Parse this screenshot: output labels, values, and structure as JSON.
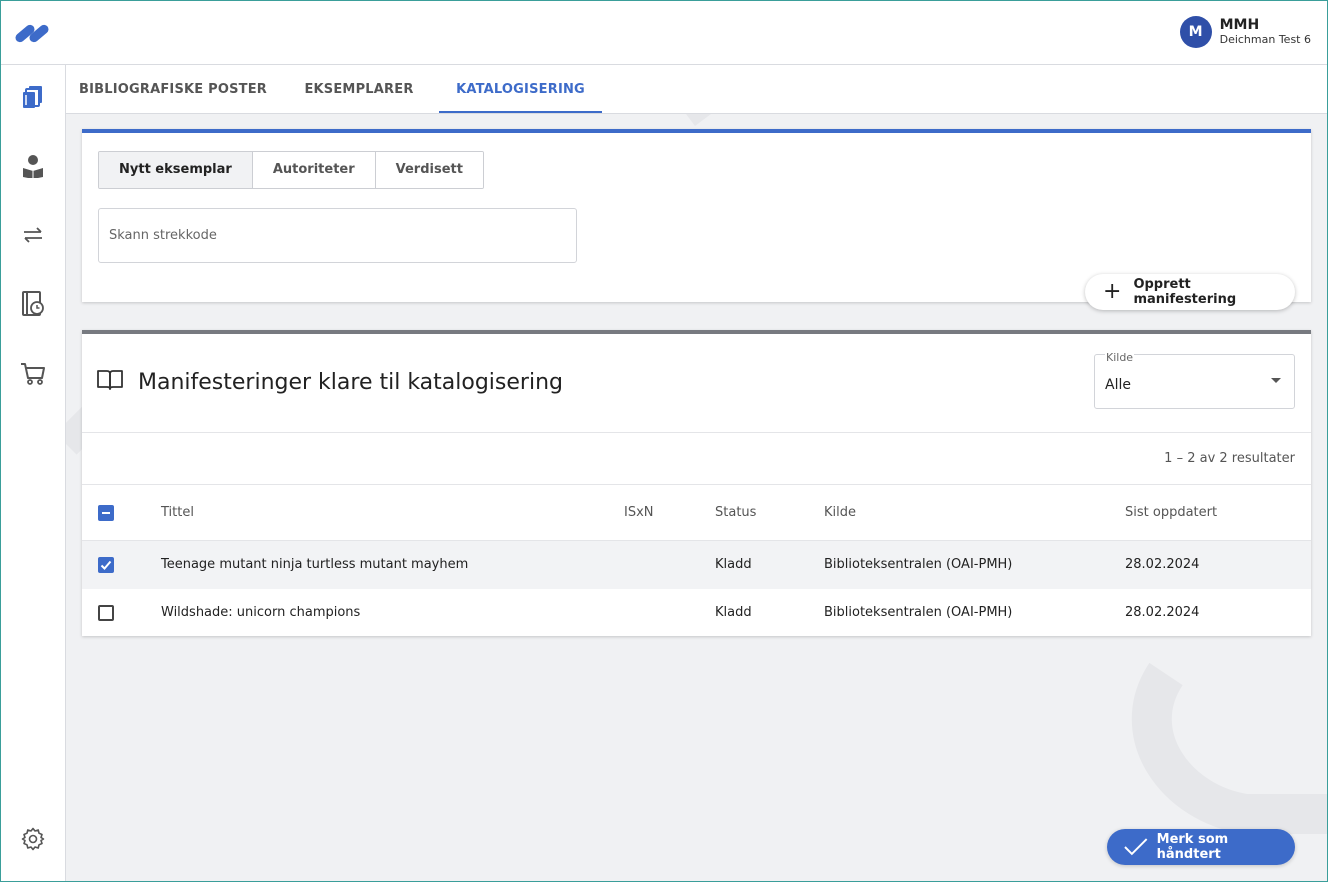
{
  "user": {
    "initial": "M",
    "name": "MMH",
    "org": "Deichman Test 6"
  },
  "sidebar": {
    "items": [
      {
        "icon": "books-icon",
        "active": true
      },
      {
        "icon": "reader-icon"
      },
      {
        "icon": "transfer-icon"
      },
      {
        "icon": "book-clock-icon"
      },
      {
        "icon": "cart-icon"
      },
      {
        "icon": "gear-icon"
      }
    ]
  },
  "tabs": [
    {
      "label": "BIBLIOGRAFISKE POSTER"
    },
    {
      "label": "EKSEMPLARER"
    },
    {
      "label": "KATALOGISERING",
      "active": true
    }
  ],
  "catalog": {
    "segments": [
      "Nytt eksemplar",
      "Autoriteter",
      "Verdisett"
    ],
    "scan_placeholder": "Skann strekkode",
    "create_label": "Opprett manifestering"
  },
  "list": {
    "title": "Manifesteringer klare til katalogisering",
    "source_label": "Kilde",
    "source_value": "Alle",
    "results": "1 – 2 av 2 resultater",
    "columns": [
      "Tittel",
      "ISxN",
      "Status",
      "Kilde",
      "Sist oppdatert"
    ],
    "rows": [
      {
        "checked": true,
        "title": "Teenage mutant ninja turtless mutant mayhem",
        "isxn": "",
        "status": "Kladd",
        "source": "Biblioteksentralen (OAI-PMH)",
        "updated": "28.02.2024"
      },
      {
        "checked": false,
        "title": "Wildshade: unicorn champions",
        "isxn": "",
        "status": "Kladd",
        "source": "Biblioteksentralen (OAI-PMH)",
        "updated": "28.02.2024"
      }
    ]
  },
  "mark_label": "Merk som håndtert",
  "colors": {
    "accent": "#3d6bc9",
    "avatar": "#2f4fa8"
  }
}
